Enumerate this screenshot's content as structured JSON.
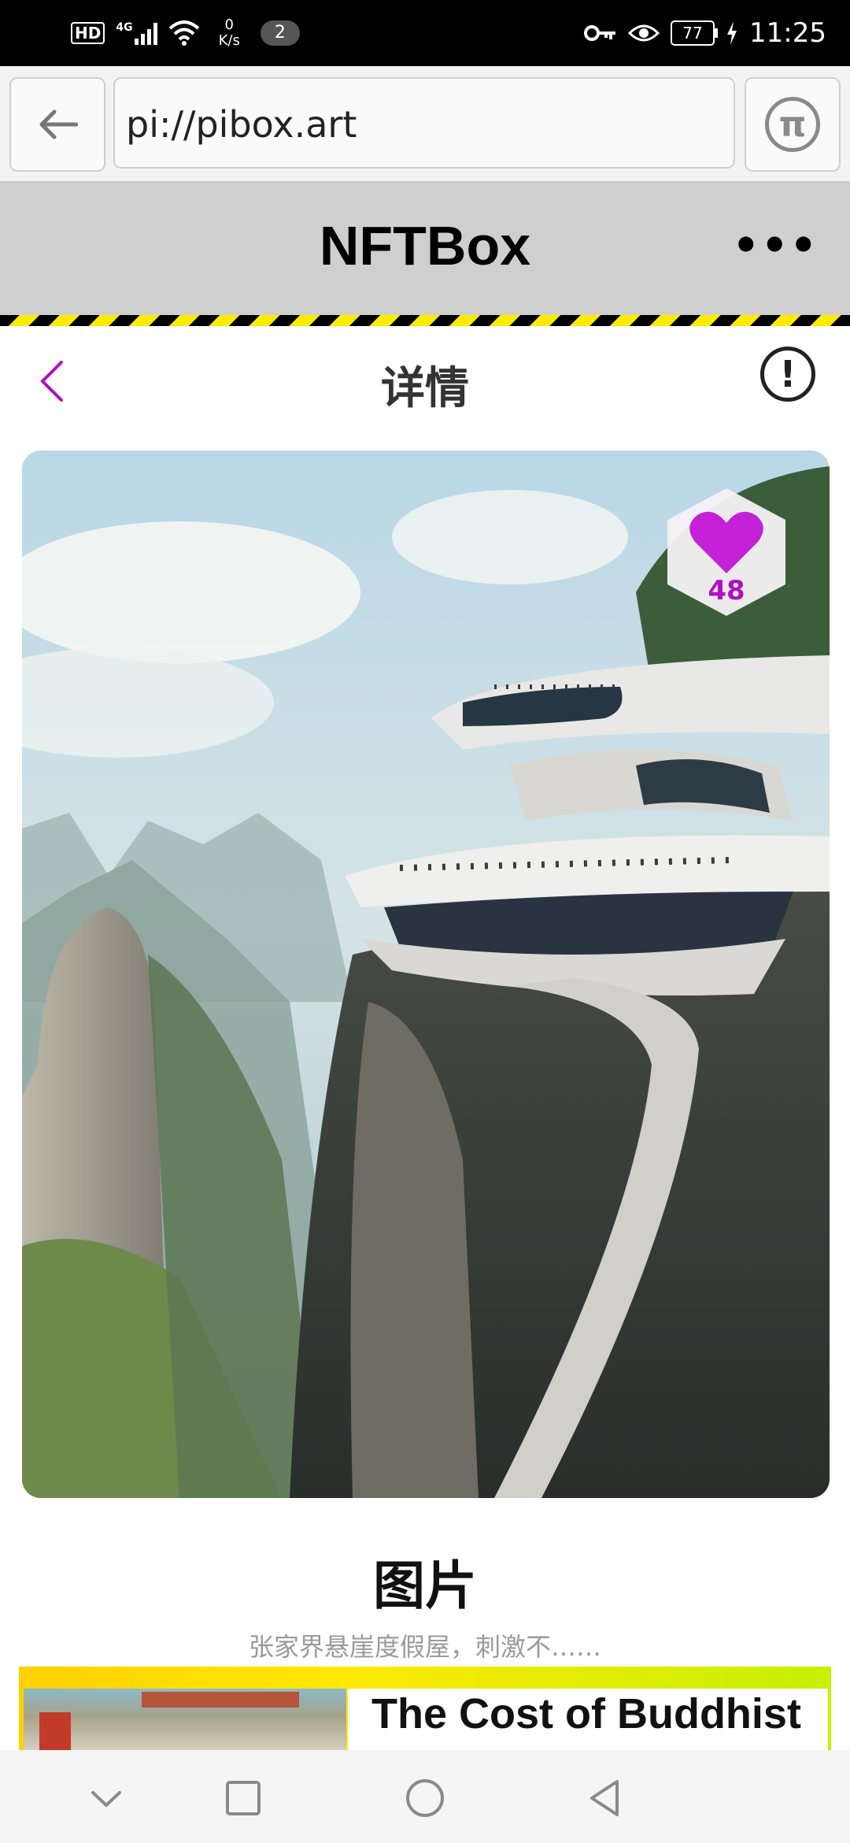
{
  "status_bar": {
    "hd": "HD",
    "network": "4G",
    "speed_value": "0",
    "speed_unit": "K/s",
    "notification_count": "2",
    "battery": "77",
    "time": "11:25"
  },
  "browser": {
    "url": "pi://pibox.art",
    "pi_symbol": "π"
  },
  "app": {
    "title": "NFTBox",
    "more": "•••"
  },
  "page": {
    "title": "详情",
    "info_symbol": "!"
  },
  "artwork": {
    "like_count": "48",
    "title": "图片",
    "description": "张家界悬崖度假屋，刺激不……"
  },
  "next_item": {
    "title": "The Cost of Buddhist"
  },
  "colors": {
    "accent": "#b010c0",
    "hazard_yellow": "#ffea00",
    "header_gray": "#cfcfcf"
  }
}
